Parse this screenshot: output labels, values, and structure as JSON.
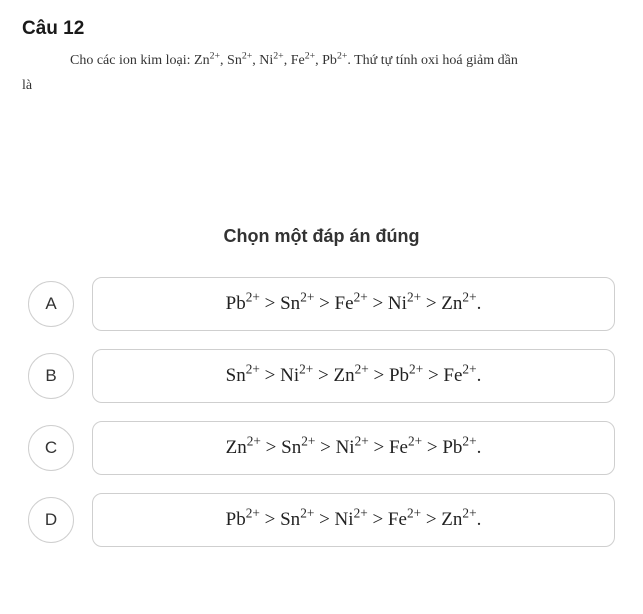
{
  "question": {
    "title": "Câu 12",
    "text_plain": "Cho các ion kim loại: Zn²⁺, Sn²⁺, Ni²⁺, Fe²⁺, Pb²⁺. Thứ tự tính oxi hoá giảm dần là",
    "prefix": "Cho các ion kim loại: ",
    "ions": [
      "Zn",
      "Sn",
      "Ni",
      "Fe",
      "Pb"
    ],
    "charge": "2+",
    "suffix": ". Thứ tự tính oxi hoá giảm dần",
    "la": "là"
  },
  "instruction": "Chọn một đáp án đúng",
  "options": [
    {
      "letter": "A",
      "order": [
        "Pb",
        "Sn",
        "Fe",
        "Ni",
        "Zn"
      ]
    },
    {
      "letter": "B",
      "order": [
        "Sn",
        "Ni",
        "Zn",
        "Pb",
        "Fe"
      ]
    },
    {
      "letter": "C",
      "order": [
        "Zn",
        "Sn",
        "Ni",
        "Fe",
        "Pb"
      ]
    },
    {
      "letter": "D",
      "order": [
        "Pb",
        "Sn",
        "Ni",
        "Fe",
        "Zn"
      ]
    }
  ],
  "charge": "2+"
}
